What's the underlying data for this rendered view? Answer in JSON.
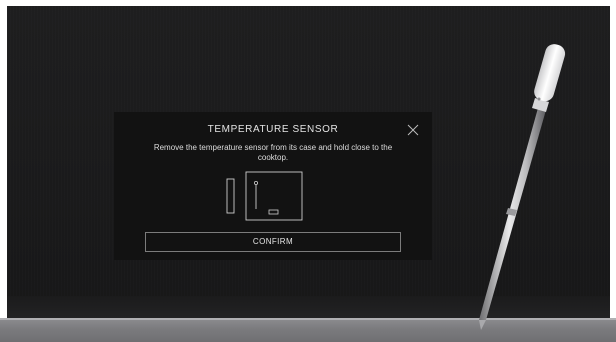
{
  "dialog": {
    "title": "TEMPERATURE SENSOR",
    "message": "Remove the temperature sensor from its case and hold close to the cooktop.",
    "confirm_label": "CONFIRM",
    "close_icon": "close-icon"
  },
  "colors": {
    "cooktop": "#1c1c1d",
    "dialog_background": "#121212",
    "text": "#e6e6e6",
    "button_border": "#7c7c7c",
    "counter": "#808083"
  },
  "icons": {
    "illustration": "sensor-in-case-icon",
    "probe": "temperature-probe"
  }
}
